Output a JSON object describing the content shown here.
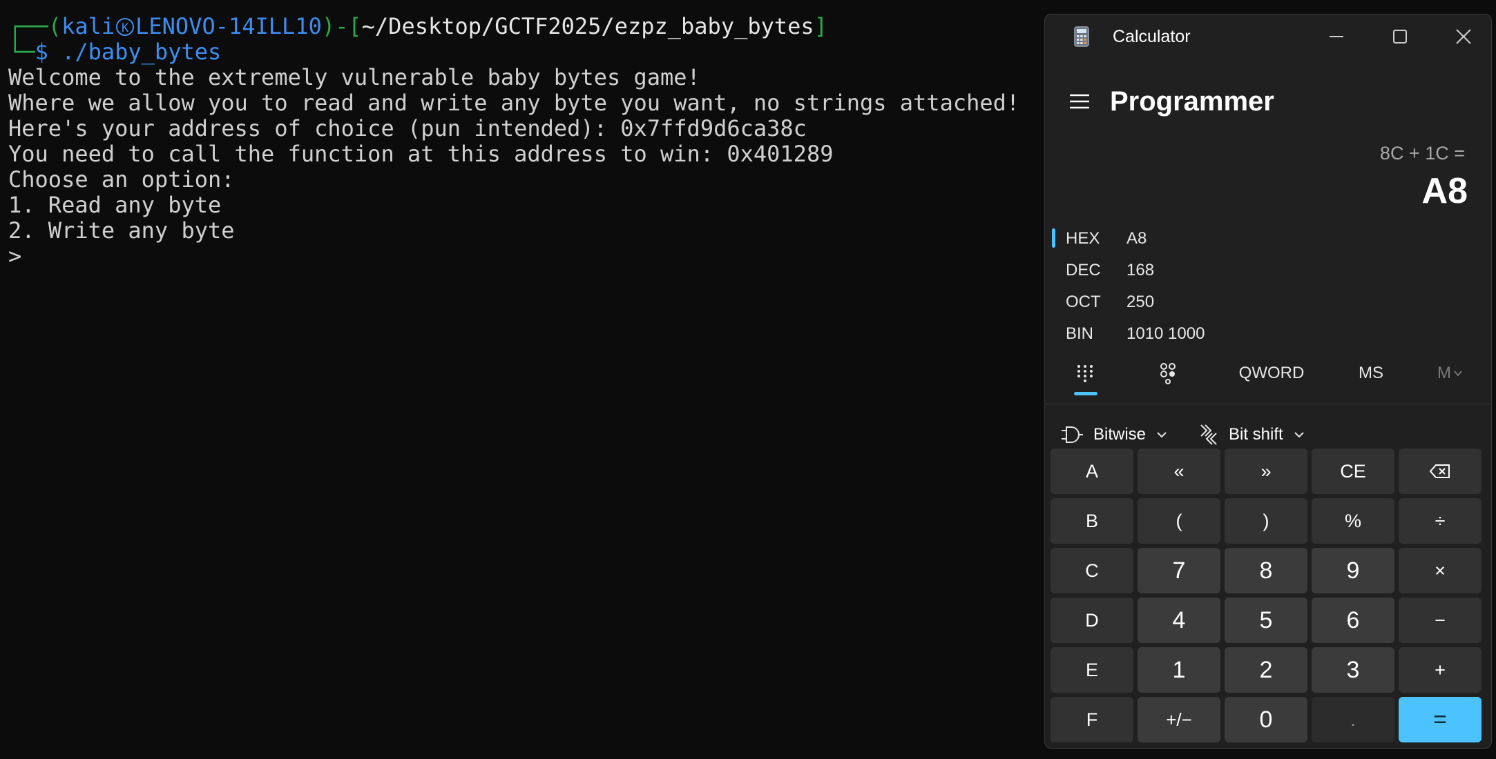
{
  "terminal": {
    "prompt": {
      "open": "┌──(",
      "user": "kali",
      "host": "LENOVO-14ILL10",
      "sep": ")-[",
      "path": "~/Desktop/GCTF2025/ezpz_baby_bytes",
      "close": "]",
      "corner": "└─",
      "dollar": "$",
      "command": " ./baby_bytes"
    },
    "lines": [
      "Welcome to the extremely vulnerable baby bytes game!",
      "Where we allow you to read and write any byte you want, no strings attached!",
      "Here's your address of choice (pun intended): 0x7ffd9d6ca38c",
      "You need to call the function at this address to win: 0x401289",
      "Choose an option:",
      "1. Read any byte",
      "2. Write any byte",
      ">"
    ]
  },
  "calculator": {
    "title": "Calculator",
    "mode": "Programmer",
    "expression": "8C + 1C =",
    "result": "A8",
    "bases": [
      {
        "label": "HEX",
        "value": "A8",
        "selected": true
      },
      {
        "label": "DEC",
        "value": "168",
        "selected": false
      },
      {
        "label": "OCT",
        "value": "250",
        "selected": false
      },
      {
        "label": "BIN",
        "value": "1010 1000",
        "selected": false
      }
    ],
    "toolbar": {
      "word_size": "QWORD",
      "ms": "MS",
      "mem": "M"
    },
    "dropdowns": {
      "bitwise": "Bitwise",
      "bitshift": "Bit shift"
    },
    "keys": [
      [
        "A",
        "«",
        "»",
        "CE",
        "⌫"
      ],
      [
        "B",
        "(",
        ")",
        "%",
        "÷"
      ],
      [
        "C",
        "7",
        "8",
        "9",
        "×"
      ],
      [
        "D",
        "4",
        "5",
        "6",
        "−"
      ],
      [
        "E",
        "1",
        "2",
        "3",
        "+"
      ],
      [
        "F",
        "+/−",
        "0",
        ".",
        "="
      ]
    ],
    "accent": "#4cc2ff"
  }
}
